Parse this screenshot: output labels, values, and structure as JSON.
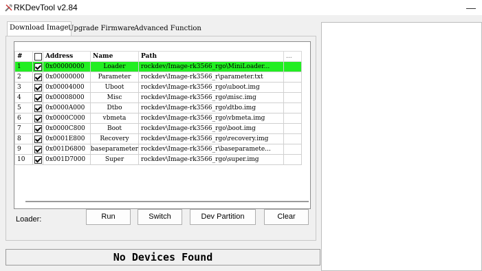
{
  "window": {
    "title": "RKDevTool v2.84",
    "minimize_label": "—"
  },
  "tabs": [
    {
      "label": "Download Image",
      "active": true
    },
    {
      "label": "Upgrade Firmware",
      "active": false
    },
    {
      "label": "Advanced Function",
      "active": false
    }
  ],
  "grid": {
    "headers": {
      "num": "#",
      "address": "Address",
      "name": "Name",
      "path": "Path",
      "extra": "..."
    },
    "rows": [
      {
        "num": "1",
        "checked": true,
        "address": "0x00000000",
        "name": "Loader",
        "path": "rockdev/Image-rk3566_rgo\\MiniLoader...",
        "selected": true
      },
      {
        "num": "2",
        "checked": true,
        "address": "0x00000000",
        "name": "Parameter",
        "path": "rockdev\\Image-rk3566_r\\parameter.txt",
        "selected": false
      },
      {
        "num": "3",
        "checked": true,
        "address": "0x00004000",
        "name": "Uboot",
        "path": "rockdev\\Image-rk3566_rgo\\uboot.img",
        "selected": false
      },
      {
        "num": "4",
        "checked": true,
        "address": "0x00008000",
        "name": "Misc",
        "path": "rockdev\\Image-rk3566_rgo\\misc.img",
        "selected": false
      },
      {
        "num": "5",
        "checked": true,
        "address": "0x0000A000",
        "name": "Dtbo",
        "path": "rockdev\\Image-rk3566_rgo\\dtbo.img",
        "selected": false
      },
      {
        "num": "6",
        "checked": true,
        "address": "0x0000C000",
        "name": "vbmeta",
        "path": "rockdev\\Image-rk3566_rgo\\vbmeta.img",
        "selected": false
      },
      {
        "num": "7",
        "checked": true,
        "address": "0x0000C800",
        "name": "Boot",
        "path": "rockdev\\Image-rk3566_rgo\\boot.img",
        "selected": false
      },
      {
        "num": "8",
        "checked": true,
        "address": "0x0001E800",
        "name": "Recovery",
        "path": "rockdev\\Image-rk3566_rgo\\recovery.img",
        "selected": false
      },
      {
        "num": "9",
        "checked": true,
        "address": "0x001D6800",
        "name": "baseparameter",
        "path": "rockdev\\Image-rk3566_r\\baseparamete...",
        "selected": false
      },
      {
        "num": "10",
        "checked": true,
        "address": "0x001D7000",
        "name": "Super",
        "path": "rockdev\\Image-rk3566_rgo\\super.img",
        "selected": false
      }
    ]
  },
  "loader_label": "Loader:",
  "buttons": {
    "run": "Run",
    "switch": "Switch",
    "dev_partition": "Dev Partition",
    "clear": "Clear"
  },
  "status_text": "No Devices Found",
  "colors": {
    "selected_row": "#22ee22"
  }
}
